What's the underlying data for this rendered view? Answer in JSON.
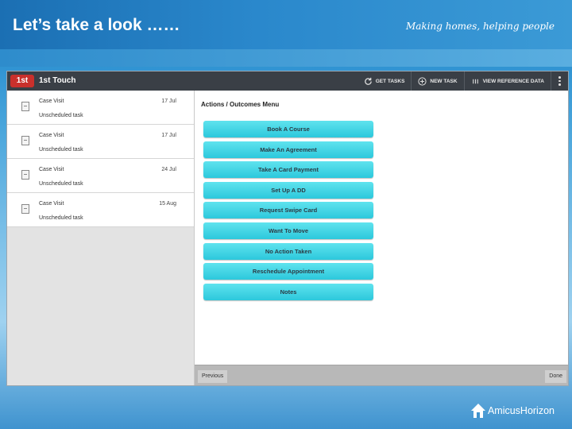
{
  "slide": {
    "title": "Let’s take a look ……",
    "tagline": "Making homes, helping people",
    "brand": "AmicusHorizon"
  },
  "app": {
    "logo_text": "1st",
    "name": "1st Touch",
    "toolbar": {
      "get_tasks": "GET TASKS",
      "new_task": "NEW TASK",
      "view_reference_data": "VIEW REFERENCE DATA"
    },
    "tasks": [
      {
        "title": "Case Visit",
        "subtitle": "Unscheduled task",
        "date": "17 Jul"
      },
      {
        "title": "Case Visit",
        "subtitle": "Unscheduled task",
        "date": "17 Jul"
      },
      {
        "title": "Case Visit",
        "subtitle": "Unscheduled task",
        "date": "24 Jul"
      },
      {
        "title": "Case Visit",
        "subtitle": "Unscheduled task",
        "date": "15 Aug"
      }
    ],
    "panel": {
      "title": "Actions / Outcomes Menu",
      "actions": [
        "Book A Course",
        "Make An Agreement",
        "Take A Card Payment",
        "Set Up A DD",
        "Request Swipe Card",
        "Want To Move",
        "No Action Taken",
        "Reschedule Appointment",
        "Notes"
      ],
      "previous_label": "Previous",
      "done_label": "Done"
    }
  },
  "colors": {
    "action_button": "#2cc8dc",
    "app_bar": "#3a3f46",
    "logo_red": "#c9302c"
  }
}
